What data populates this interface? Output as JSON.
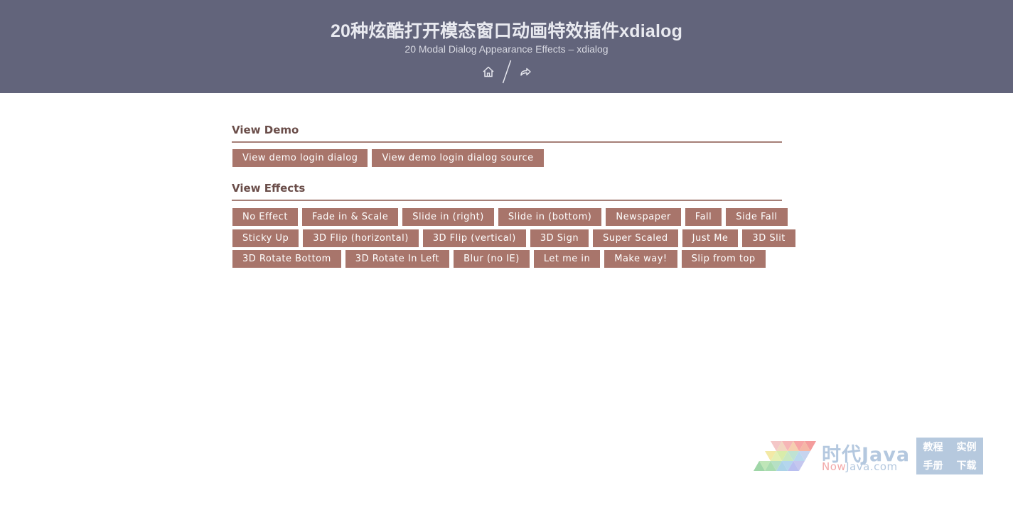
{
  "header": {
    "title": "20种炫酷打开模态窗口动画特效插件xdialog",
    "subtitle": "20 Modal Dialog Appearance Effects – xdialog",
    "nav": [
      {
        "icon": "home-icon"
      },
      {
        "icon": "share-icon"
      }
    ]
  },
  "demo_section": {
    "title": "View Demo",
    "buttons": [
      "View demo login dialog",
      "View demo login dialog source"
    ]
  },
  "effects_section": {
    "title": "View Effects",
    "rows": [
      [
        "No Effect",
        "Fade in & Scale",
        "Slide in (right)",
        "Slide in (bottom)",
        "Newspaper",
        "Fall",
        "Side Fall"
      ],
      [
        "Sticky Up",
        "3D Flip (horizontal)",
        "3D Flip (vertical)",
        "3D Sign",
        "Super Scaled",
        "Just Me",
        "3D Slit"
      ],
      [
        "3D Rotate Bottom",
        "3D Rotate In Left",
        "Blur (no IE)",
        "Let me in",
        "Make way!",
        "Slip from top"
      ]
    ]
  },
  "footer_logo": {
    "brand": "时代Java",
    "domain_prefix": "Now",
    "domain_rest": "Java.com",
    "links": [
      "教程",
      "实例",
      "手册",
      "下载"
    ]
  },
  "colors": {
    "header_bg": "#62647b",
    "button_bg": "#a8756b",
    "section_title": "#6b4e4a",
    "rule": "#a57f77",
    "logo_blue": "#b4c8df"
  }
}
